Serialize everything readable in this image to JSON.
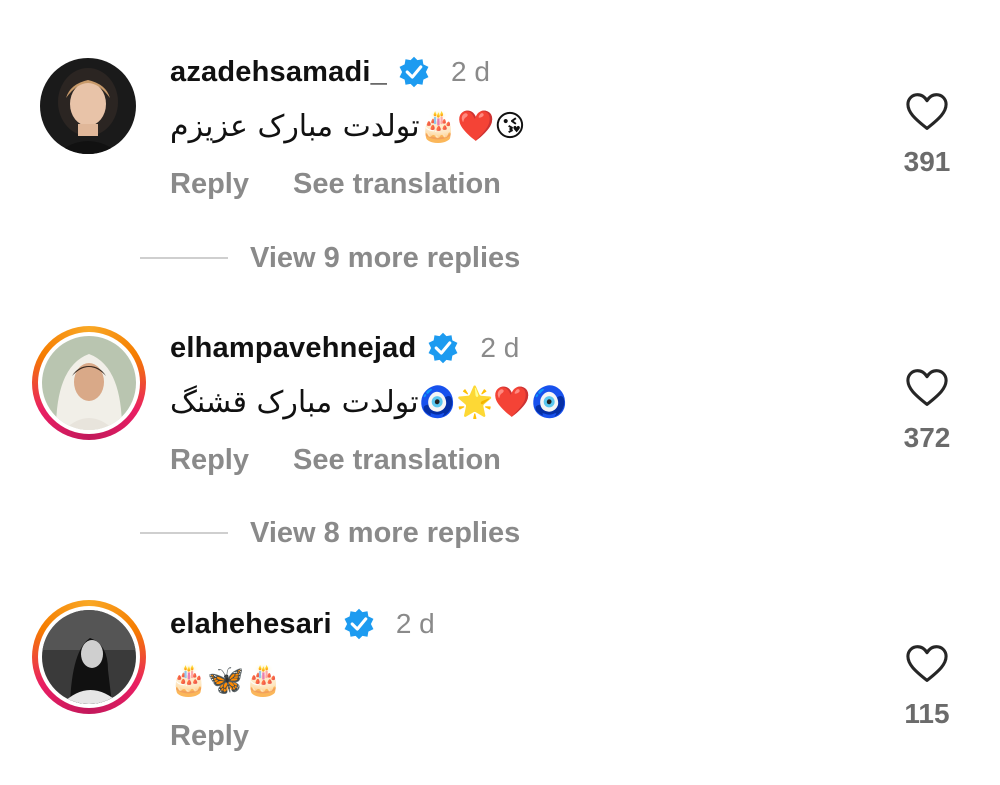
{
  "comments": [
    {
      "username": "azadehsamadi_",
      "time": "2 d",
      "text": "تولدت مبارک عزیزم🎂❤️😘",
      "reply_label": "Reply",
      "translate_label": "See translation",
      "likes": "391",
      "view_replies_label": "View 9 more replies",
      "avatar": "avatar-photo",
      "has_story_ring": false
    },
    {
      "username": "elhampavehnejad",
      "time": "2 d",
      "text": "تولدت مبارک قشنگ🧿🌟❤️🧿",
      "reply_label": "Reply",
      "translate_label": "See translation",
      "likes": "372",
      "view_replies_label": "View 8 more replies",
      "avatar": "avatar-photo",
      "has_story_ring": true
    },
    {
      "username": "elahehesari",
      "time": "2 d",
      "text": "🎂🦋🎂",
      "reply_label": "Reply",
      "likes": "115",
      "avatar": "avatar-photo",
      "has_story_ring": true
    }
  ],
  "colors": {
    "verified_blue": "#1d9bf0",
    "muted_text": "#8a8a8a",
    "count_text": "#6b6b6b",
    "story_ring": "#e91e63"
  },
  "icons": {
    "verified": "verified-badge-icon",
    "like": "heart-outline-icon"
  }
}
